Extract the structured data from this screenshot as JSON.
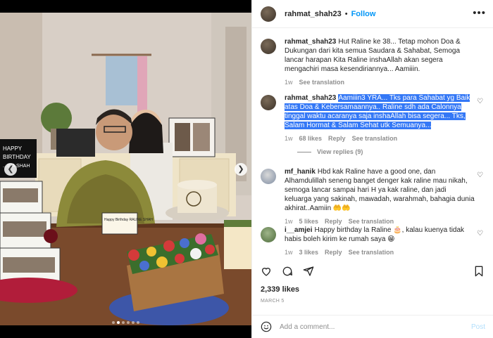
{
  "post": {
    "username": "rahmat_shah23",
    "follow_label": "Follow",
    "separator": "•",
    "more_label": "•••",
    "likes": "2,339 likes",
    "date": "MARCH 5",
    "photo": {
      "cake_sign_line1": "HAPPY",
      "cake_sign_line2": "BIRTHDAY",
      "cake_sign_line3": "...INA SHAH",
      "topper": "Happy Birthday RALINE SHAH"
    }
  },
  "comments": [
    {
      "user": "rahmat_shah23",
      "text": "Hut Raline ke 38... Tetap mohon Doa & Dukungan dari kita semua Saudara & Sahabat, Semoga lancar harapan Kita Raline inshaAllah akan segera mengachiri masa kesendiriannya... Aamiiin.",
      "time": "1w",
      "action": "See translation"
    },
    {
      "user": "rahmat_shah23",
      "text": "Aamiiin3 YRA... Tks para Sahabat yg Baik atas Doa & Kebersamaannya.. Raline sdh ada Calonnya tinggal waktu acaranya saja inshaAllah bisa segera... Tks, Salam Hormat & Salam Sehat utk Semuanya...",
      "time": "1w",
      "likes": "68 likes",
      "reply": "Reply",
      "action": "See translation",
      "view_replies": "View replies (9)"
    },
    {
      "user": "mf_hanik",
      "text": "Hbd kak Raline have a good one, dan Alhamdulillah seneng banget denger kak raline mau nikah, semoga lancar sampai hari H ya kak raline, dan jadi keluarga yang sakinah, mawadah, warahmah, bahagia dunia akhirat..Aamiin 🤲🤲",
      "time": "1w",
      "likes": "5 likes",
      "reply": "Reply",
      "action": "See translation"
    },
    {
      "user": "i__amjei",
      "text": "Happy birthday la Raline 🎂, kalau kuenya tidak habis boleh kirim ke rumah saya 😁",
      "time": "1w",
      "likes": "3 likes",
      "reply": "Reply",
      "action": "See translation"
    }
  ],
  "add_comment": {
    "placeholder": "Add a comment...",
    "post_label": "Post"
  },
  "icons": {
    "like": "heart-icon",
    "comment": "comment-icon",
    "share": "share-icon",
    "save": "bookmark-icon",
    "emoji": "emoji-icon"
  },
  "colors": {
    "accent": "#0095f6",
    "highlight": "#3478f6",
    "muted": "#8e8e8e"
  }
}
